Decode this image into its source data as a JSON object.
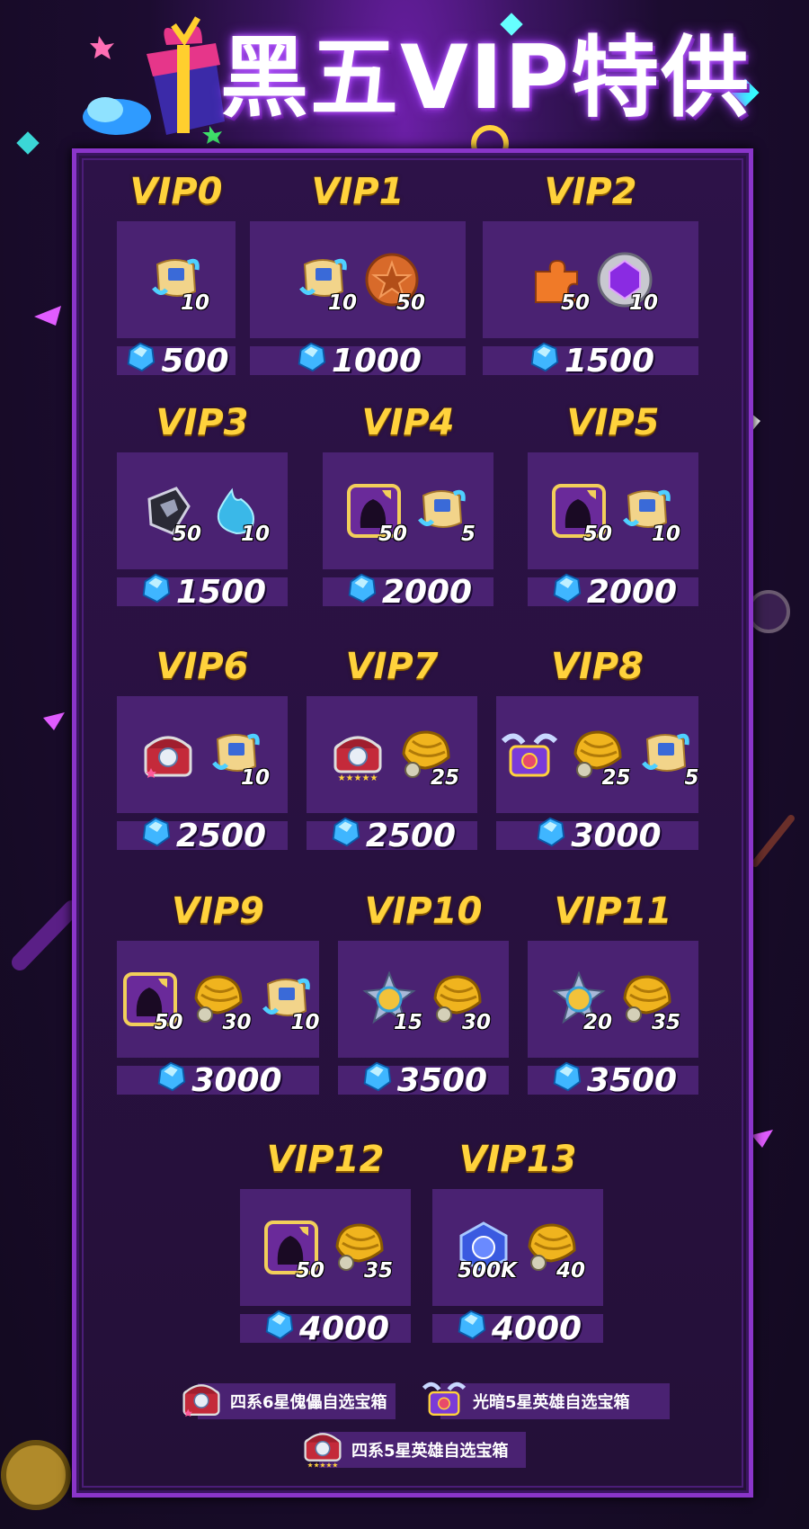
{
  "banner": {
    "title": "黑五VIP特供"
  },
  "tiers": [
    {
      "label": "VIP0",
      "items": [
        {
          "icon": "scroll-icon",
          "qty": "10"
        }
      ],
      "price": "500"
    },
    {
      "label": "VIP1",
      "items": [
        {
          "icon": "scroll-icon",
          "qty": "10"
        },
        {
          "icon": "bronze-star-coin-icon",
          "qty": "50"
        }
      ],
      "price": "1000"
    },
    {
      "label": "VIP2",
      "items": [
        {
          "icon": "puzzle-piece-icon",
          "qty": "50"
        },
        {
          "icon": "purple-gem-orb-icon",
          "qty": "10"
        }
      ],
      "price": "1500"
    },
    {
      "label": "VIP3",
      "items": [
        {
          "icon": "dark-crystal-icon",
          "qty": "50"
        },
        {
          "icon": "blue-flame-icon",
          "qty": "10"
        }
      ],
      "price": "1500"
    },
    {
      "label": "VIP4",
      "items": [
        {
          "icon": "hero-shard-card-icon",
          "qty": "50"
        },
        {
          "icon": "scroll-icon",
          "qty": "5"
        }
      ],
      "price": "2000"
    },
    {
      "label": "VIP5",
      "items": [
        {
          "icon": "hero-shard-card-icon",
          "qty": "50"
        },
        {
          "icon": "scroll-icon",
          "qty": "10"
        }
      ],
      "price": "2000"
    },
    {
      "label": "VIP6",
      "items": [
        {
          "icon": "red-chest-icon",
          "qty": ""
        },
        {
          "icon": "scroll-icon",
          "qty": "10"
        }
      ],
      "price": "2500"
    },
    {
      "label": "VIP7",
      "items": [
        {
          "icon": "red-chest-five-star-icon",
          "qty": ""
        },
        {
          "icon": "gold-shell-icon",
          "qty": "25"
        }
      ],
      "price": "2500"
    },
    {
      "label": "VIP8",
      "items": [
        {
          "icon": "winged-chest-icon",
          "qty": ""
        },
        {
          "icon": "gold-shell-icon",
          "qty": "25"
        },
        {
          "icon": "scroll-icon",
          "qty": "5"
        }
      ],
      "price": "3000"
    },
    {
      "label": "VIP9",
      "items": [
        {
          "icon": "hero-shard-card-icon",
          "qty": "50"
        },
        {
          "icon": "gold-shell-icon",
          "qty": "30"
        },
        {
          "icon": "scroll-icon",
          "qty": "10"
        }
      ],
      "price": "3000"
    },
    {
      "label": "VIP10",
      "items": [
        {
          "icon": "star-medal-icon",
          "qty": "15"
        },
        {
          "icon": "gold-shell-icon",
          "qty": "30"
        }
      ],
      "price": "3500"
    },
    {
      "label": "VIP11",
      "items": [
        {
          "icon": "star-medal-icon",
          "qty": "20"
        },
        {
          "icon": "gold-shell-icon",
          "qty": "35"
        }
      ],
      "price": "3500"
    },
    {
      "label": "VIP12",
      "items": [
        {
          "icon": "hero-shard-card-icon",
          "qty": "50"
        },
        {
          "icon": "gold-shell-icon",
          "qty": "35"
        }
      ],
      "price": "4000"
    },
    {
      "label": "VIP13",
      "items": [
        {
          "icon": "blue-crystal-icon",
          "qty": "500K"
        },
        {
          "icon": "gold-shell-icon",
          "qty": "40"
        }
      ],
      "price": "4000"
    }
  ],
  "legend": [
    {
      "icon": "red-chest-icon",
      "text": "四系6星傀儡自选宝箱"
    },
    {
      "icon": "winged-chest-icon",
      "text": "光暗5星英雄自选宝箱"
    },
    {
      "icon": "red-chest-five-star-icon",
      "text": "四系5星英雄自选宝箱"
    }
  ],
  "colors": {
    "label_gold": "#ffd23c",
    "panel": "#4a2272",
    "frame": "#8a35c9",
    "gem_blue": "#3fb6ff"
  }
}
